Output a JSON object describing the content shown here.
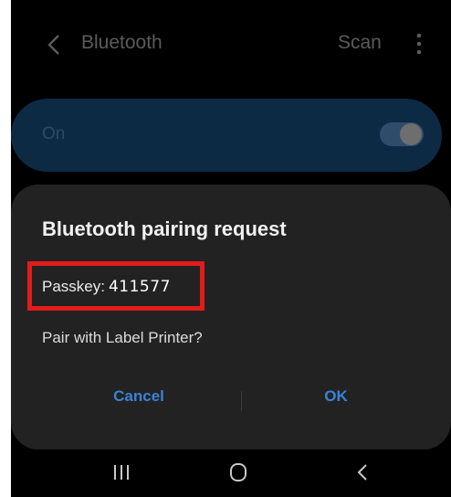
{
  "header": {
    "title": "Bluetooth",
    "scan_label": "Scan"
  },
  "toggle_card": {
    "label": "On",
    "enabled": true
  },
  "dialog": {
    "title": "Bluetooth pairing request",
    "passkey_label": "Passkey:",
    "passkey_value": "411577",
    "message": "Pair with Label Printer?",
    "cancel_label": "Cancel",
    "ok_label": "OK"
  },
  "colors": {
    "accent": "#3b82d6",
    "highlight_box": "#e31b1b",
    "dialog_bg": "#222222",
    "toggle_card_bg": "#0d2a44"
  },
  "icons": {
    "back": "chevron-left-icon",
    "more": "more-vertical-icon",
    "nav_recents": "recents-icon",
    "nav_home": "home-icon",
    "nav_back": "back-icon"
  }
}
